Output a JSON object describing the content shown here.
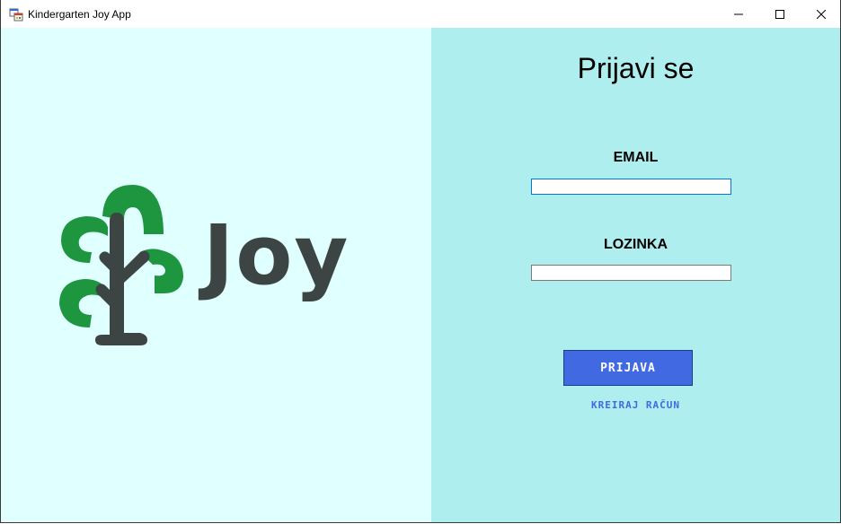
{
  "window": {
    "title": "Kindergarten Joy App",
    "app_icon": "windows-forms-app-icon",
    "controls": {
      "minimize_icon": "minimize-icon",
      "maximize_icon": "maximize-icon",
      "close_icon": "close-icon"
    }
  },
  "brand": {
    "logo_text": "Joy",
    "logo_icon": "tree-icon",
    "tree_color": "#1e9640",
    "text_color": "#3c4544"
  },
  "login": {
    "heading": "Prijavi se",
    "email_label": "EMAIL",
    "email_value": "",
    "password_label": "LOZINKA",
    "password_value": "",
    "submit_label": "PRIJAVA",
    "create_account_label": "KREIRAJ RAČUN"
  },
  "colors": {
    "left_bg": "#e0ffff",
    "right_bg": "#afeeee",
    "accent": "#4169e1"
  }
}
